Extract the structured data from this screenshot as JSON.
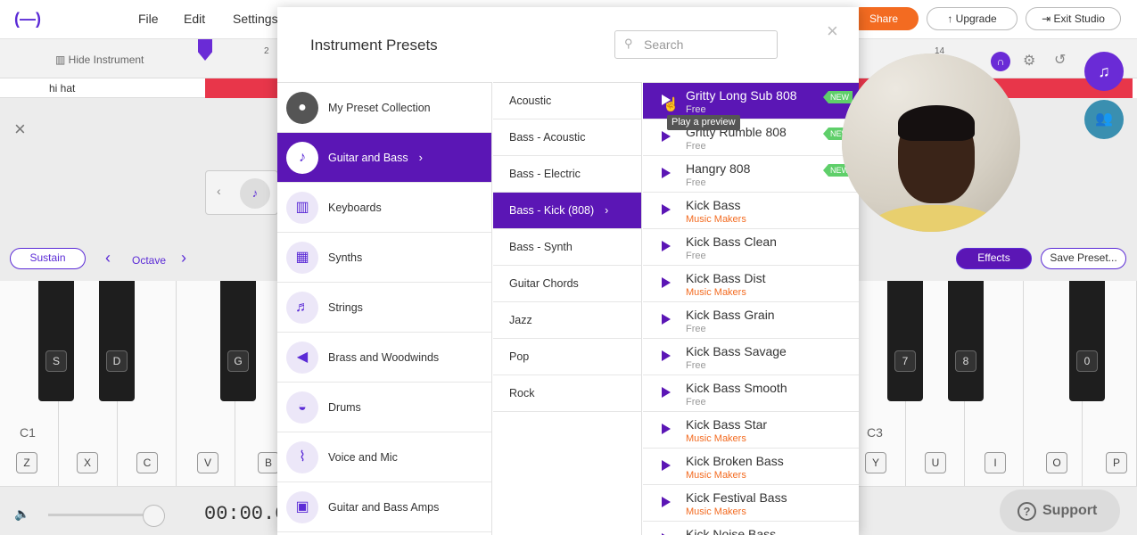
{
  "topbar": {
    "menu": [
      "File",
      "Edit",
      "Settings"
    ],
    "share_label": "Share",
    "upgrade_label": "Upgrade",
    "exit_label": "Exit Studio"
  },
  "track": {
    "hide_instrument_label": "Hide Instrument",
    "ruler_marks": [
      "2",
      "14"
    ],
    "track_name": "hi hat"
  },
  "instrument": {
    "sustain_label": "Sustain",
    "octave_label": "Octave",
    "effects_label": "Effects",
    "save_preset_label": "Save Preset...",
    "octave_c1": "C1",
    "octave_c3": "C3",
    "black_keys_left": [
      "S",
      "D",
      "G"
    ],
    "black_keys_right": [
      "7",
      "8",
      "0"
    ],
    "white_keys_left": [
      "Z",
      "X",
      "C",
      "V",
      "B"
    ],
    "white_keys_right": [
      "Y",
      "U",
      "I",
      "O",
      "P"
    ],
    "time_display": "00:00.0"
  },
  "modal": {
    "title": "Instrument Presets",
    "search_placeholder": "Search",
    "categories": [
      {
        "label": "My Preset Collection",
        "icon": "avatar"
      },
      {
        "label": "Guitar and Bass",
        "icon": "guitar-icon",
        "selected": true
      },
      {
        "label": "Keyboards",
        "icon": "keyboard-icon"
      },
      {
        "label": "Synths",
        "icon": "synth-icon"
      },
      {
        "label": "Strings",
        "icon": "violin-icon"
      },
      {
        "label": "Brass and Woodwinds",
        "icon": "horn-icon"
      },
      {
        "label": "Drums",
        "icon": "drum-icon"
      },
      {
        "label": "Voice and Mic",
        "icon": "mic-icon"
      },
      {
        "label": "Guitar and Bass Amps",
        "icon": "amp-icon"
      }
    ],
    "subcategories": [
      "Acoustic",
      "Bass - Acoustic",
      "Bass - Electric",
      "Bass - Kick (808)",
      "Bass - Synth",
      "Guitar Chords",
      "Jazz",
      "Pop",
      "Rock"
    ],
    "selected_subcategory": "Bass - Kick (808)",
    "presets": [
      {
        "name": "Gritty Long Sub 808",
        "tag": "Free",
        "new": "NEW"
      },
      {
        "name": "Gritty Rumble 808",
        "tag": "Free",
        "new": "NEW"
      },
      {
        "name": "Hangry 808",
        "tag": "Free",
        "new": "NEW"
      },
      {
        "name": "Kick Bass",
        "tag": "Music Makers"
      },
      {
        "name": "Kick Bass Clean",
        "tag": "Free"
      },
      {
        "name": "Kick Bass Dist",
        "tag": "Music Makers"
      },
      {
        "name": "Kick Bass Grain",
        "tag": "Free"
      },
      {
        "name": "Kick Bass Savage",
        "tag": "Free"
      },
      {
        "name": "Kick Bass Smooth",
        "tag": "Free"
      },
      {
        "name": "Kick Bass Star",
        "tag": "Music Makers"
      },
      {
        "name": "Kick Broken Bass",
        "tag": "Music Makers"
      },
      {
        "name": "Kick Festival Bass",
        "tag": "Music Makers"
      },
      {
        "name": "Kick Noise Bass",
        "tag": ""
      }
    ],
    "tooltip": "Play a preview"
  },
  "support_label": "Support",
  "colors": {
    "accent": "#5b16b5",
    "share": "#f36b21",
    "new_badge": "#5fcf6a",
    "track": "#e8364a"
  }
}
